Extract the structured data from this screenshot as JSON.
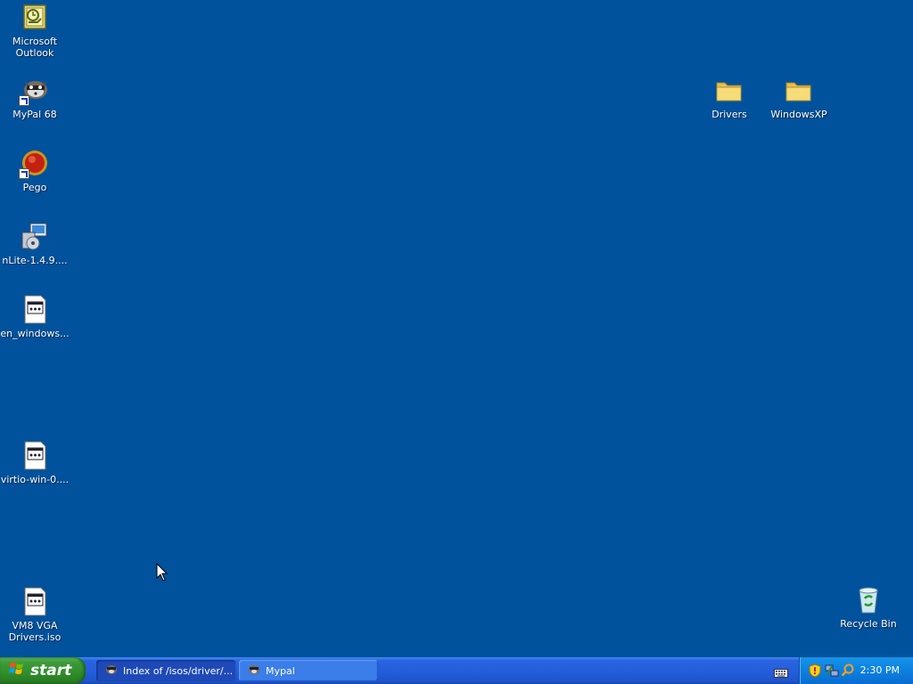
{
  "desktop": {
    "icons": [
      {
        "label": "Microsoft Outlook",
        "icon": "outlook-icon"
      },
      {
        "label": "MyPal 68",
        "icon": "mypal-icon"
      },
      {
        "label": "Pego",
        "icon": "pego-icon"
      },
      {
        "label": "nLite-1.4.9....",
        "icon": "installer-icon"
      },
      {
        "label": "en_windows...",
        "icon": "iso-file-icon"
      },
      {
        "label": "virtio-win-0....",
        "icon": "iso-file-icon"
      },
      {
        "label": "VM8 VGA Drivers.iso",
        "icon": "iso-file-icon"
      },
      {
        "label": "Drivers",
        "icon": "folder-icon"
      },
      {
        "label": "WindowsXP",
        "icon": "folder-icon"
      },
      {
        "label": "Recycle Bin",
        "icon": "recycle-bin-icon"
      }
    ]
  },
  "taskbar": {
    "start_label": "start",
    "tasks": [
      {
        "label": "Index of /isos/driver/...",
        "icon": "mypal-icon",
        "active": true
      },
      {
        "label": "Mypal",
        "icon": "mypal-icon",
        "active": false
      }
    ],
    "tray": {
      "icons": [
        "keyboard-icon",
        "security-shield-icon",
        "network-icon",
        "search-icon"
      ],
      "clock": "2:30 PM"
    }
  },
  "colors": {
    "desktop_bg": "#00529c",
    "taskbar_blue": "#245edb",
    "start_green": "#3c9b38",
    "tray_blue": "#0c80e0"
  }
}
